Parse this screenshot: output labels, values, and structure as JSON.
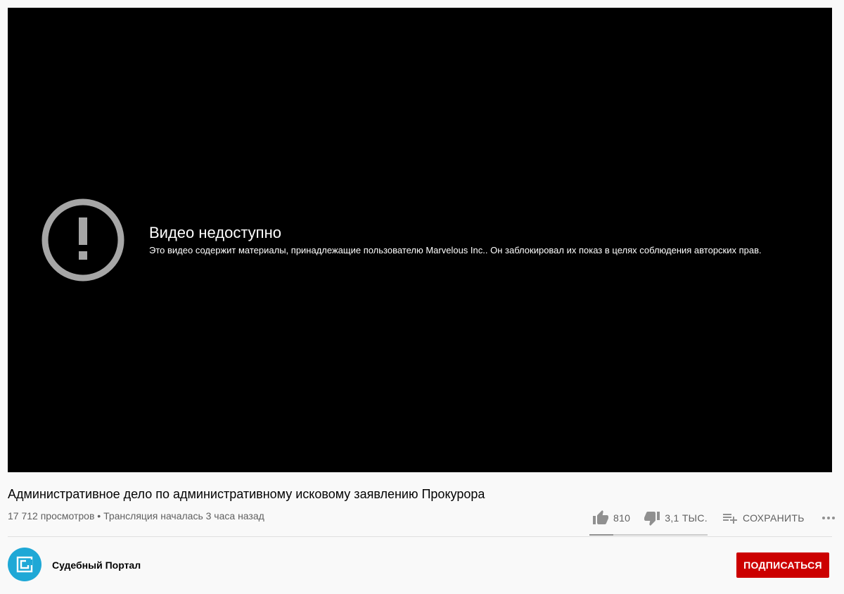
{
  "player": {
    "error_title": "Видео недоступно",
    "error_message": "Это видео содержит материалы, принадлежащие пользователю Marvelous Inc.. Он заблокировал их показ в целях соблюдения авторских прав.",
    "error_icon": "alert-circle-icon"
  },
  "video": {
    "title": "Административное дело по административному исковому заявлению Прокурора",
    "views": "17 712 просмотров",
    "separator": "•",
    "stream_status": "Трансляция началась 3 часа назад"
  },
  "actions": {
    "like_count": "810",
    "dislike_count": "3,1 ТЫС.",
    "save_label": "СОХРАНИТЬ",
    "icons": [
      "thumb-up-icon",
      "thumb-down-icon",
      "playlist-add-icon",
      "more-horiz-icon"
    ],
    "like_ratio": 0.2
  },
  "channel": {
    "name": "Судебный Портал",
    "avatar_color": "#1fa8d6",
    "subscribe_label": "ПОДПИСАТЬСЯ"
  },
  "colors": {
    "player_bg": "#000000",
    "page_bg": "#f9f9f9",
    "subscribe_bg": "#cc0000",
    "icon_gray": "#909090"
  }
}
